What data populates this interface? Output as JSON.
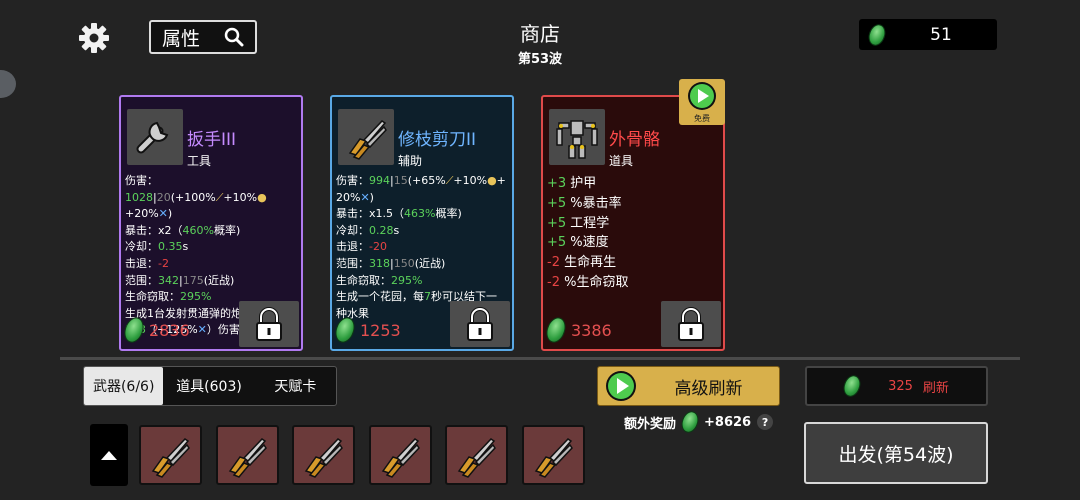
{
  "header": {
    "attr_label": "属性",
    "title": "商店",
    "wave": "第53波",
    "money": "51"
  },
  "cards": [
    {
      "name": "扳手III",
      "type": "工具",
      "name_color": "#c58bff",
      "border": "#b07af0",
      "bg": "#1c0f2b",
      "stat_lines": [
        [
          {
            "t": "伤害："
          },
          {
            "t": "1028",
            "c": "g"
          },
          {
            "t": "|"
          },
          {
            "t": "20",
            "c": "gr"
          },
          {
            "t": "(+100%"
          },
          {
            "t": "⟋",
            "c": "y"
          },
          {
            "t": "+10%"
          },
          {
            "t": "●",
            "c": "y"
          }
        ],
        [
          {
            "t": "+20%"
          },
          {
            "t": "✕",
            "c": "sky"
          },
          {
            "t": ")"
          }
        ],
        [
          {
            "t": "暴击：x2（"
          },
          {
            "t": "460%",
            "c": "g"
          },
          {
            "t": "概率)"
          }
        ],
        [
          {
            "t": "冷却："
          },
          {
            "t": "0.35",
            "c": "g"
          },
          {
            "t": "s"
          }
        ],
        [
          {
            "t": "击退："
          },
          {
            "t": "-2",
            "c": "r"
          }
        ],
        [
          {
            "t": "范围："
          },
          {
            "t": "342",
            "c": "g"
          },
          {
            "t": "|"
          },
          {
            "t": "175",
            "c": "gr"
          },
          {
            "t": "(近战)"
          }
        ],
        [
          {
            "t": "生命窃取："
          },
          {
            "t": "295%",
            "c": "g"
          }
        ],
        [
          {
            "t": "生成1台发射贯通弹的炮塔，造成"
          }
        ],
        [
          {
            "t": "533",
            "c": "g"
          },
          {
            "t": "（+125%"
          },
          {
            "t": "✕",
            "c": "sky"
          },
          {
            "t": "）伤害"
          }
        ]
      ],
      "price": "2836"
    },
    {
      "name": "修枝剪刀II",
      "type": "辅助",
      "name_color": "#6fb5ff",
      "border": "#5aa9e6",
      "bg": "#0d1f2b",
      "stat_lines": [
        [
          {
            "t": "伤害："
          },
          {
            "t": "994",
            "c": "g"
          },
          {
            "t": "|"
          },
          {
            "t": "15",
            "c": "gr"
          },
          {
            "t": "(+65%"
          },
          {
            "t": "⟋",
            "c": "y"
          },
          {
            "t": "+10%"
          },
          {
            "t": "●",
            "c": "y"
          },
          {
            "t": "+"
          }
        ],
        [
          {
            "t": "20%"
          },
          {
            "t": "✕",
            "c": "sky"
          },
          {
            "t": ")"
          }
        ],
        [
          {
            "t": "暴击：x1.5（"
          },
          {
            "t": "463%",
            "c": "g"
          },
          {
            "t": "概率)"
          }
        ],
        [
          {
            "t": "冷却："
          },
          {
            "t": "0.28",
            "c": "g"
          },
          {
            "t": "s"
          }
        ],
        [
          {
            "t": "击退："
          },
          {
            "t": "-20",
            "c": "r"
          }
        ],
        [
          {
            "t": "范围："
          },
          {
            "t": "318",
            "c": "g"
          },
          {
            "t": "|"
          },
          {
            "t": "150",
            "c": "gr"
          },
          {
            "t": "(近战)"
          }
        ],
        [
          {
            "t": "生命窃取："
          },
          {
            "t": "295%",
            "c": "g"
          }
        ],
        [
          {
            "t": "生成一个花园，每"
          },
          {
            "t": "7",
            "c": "g"
          },
          {
            "t": "秒可以结下一"
          }
        ],
        [
          {
            "t": "种水果"
          }
        ]
      ],
      "price": "1253"
    },
    {
      "name": "外骨骼",
      "type": "道具",
      "name_color": "#ff4a4a",
      "border": "#e04a4a",
      "bg": "#2a0b0b",
      "stat_lines": [
        [
          {
            "t": "+3",
            "c": "g"
          },
          {
            "t": " 护甲"
          }
        ],
        [
          {
            "t": "+5",
            "c": "g"
          },
          {
            "t": " %暴击率"
          }
        ],
        [
          {
            "t": "+5",
            "c": "g"
          },
          {
            "t": " 工程学"
          }
        ],
        [
          {
            "t": "+5",
            "c": "g"
          },
          {
            "t": " %速度"
          }
        ],
        [
          {
            "t": "-2",
            "c": "r"
          },
          {
            "t": " 生命再生"
          }
        ],
        [
          {
            "t": "-2",
            "c": "r"
          },
          {
            "t": " %生命窃取"
          }
        ]
      ],
      "price": "3386"
    }
  ],
  "free_label": "免费",
  "tabs": [
    "武器(6/6)",
    "道具(603)",
    "天赋卡"
  ],
  "pro_refresh": "高级刷新",
  "bonus_label": "额外奖励",
  "bonus_value": "+8626",
  "help": "?",
  "refresh_cost": "325",
  "refresh_label": "刷新",
  "go_label": "出发(第54波)",
  "slot_count": 6
}
